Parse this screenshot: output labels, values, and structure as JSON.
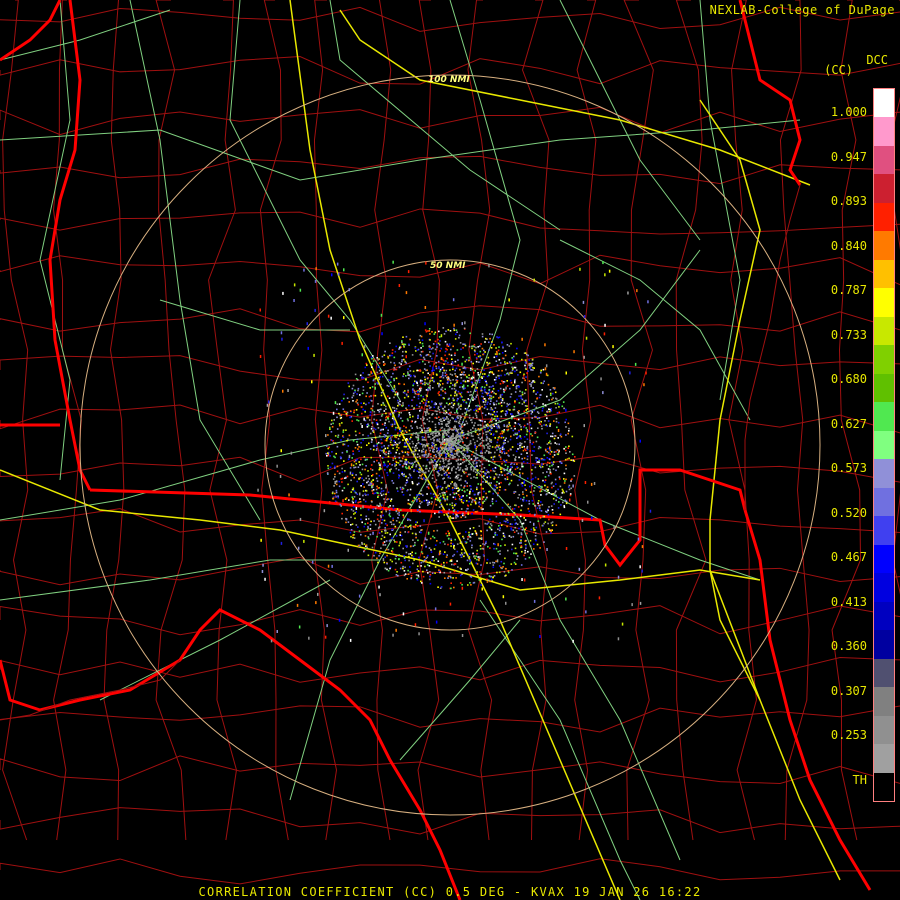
{
  "header": {
    "credit": "NEXLAB-College of DuPage",
    "product_code": "DCC",
    "unit": "(CC)"
  },
  "footer": {
    "caption": "CORRELATION COEFFICIENT (CC) 0.5 DEG - KVAX 19 JAN 26 16:22"
  },
  "range_rings": [
    {
      "label": "100 NMI"
    },
    {
      "label": "50 NMI"
    }
  ],
  "color_scale": {
    "labels": [
      "1.000",
      "0.947",
      "0.893",
      "0.840",
      "0.787",
      "0.733",
      "0.680",
      "0.627",
      "0.573",
      "0.520",
      "0.467",
      "0.413",
      "0.360",
      "0.307",
      "0.253",
      "TH"
    ],
    "colors": [
      "#ffffff",
      "#ff99cc",
      "#e05080",
      "#cc2030",
      "#ff2000",
      "#ff7a00",
      "#ffc000",
      "#ffff00",
      "#c8e800",
      "#80d000",
      "#60c000",
      "#50e850",
      "#80ff80",
      "#9090d8",
      "#7070e0",
      "#4040f0",
      "#0000ff",
      "#0000e0",
      "#0000c0",
      "#0000a0",
      "#505070",
      "#808080",
      "#909090",
      "#a0a0a0",
      "#000000"
    ]
  },
  "map_colors": {
    "state_border": "#ff0000",
    "county_border": "#a01010",
    "highway": "#e8e800",
    "road": "#80d080",
    "range_ring": "#d8b080"
  }
}
